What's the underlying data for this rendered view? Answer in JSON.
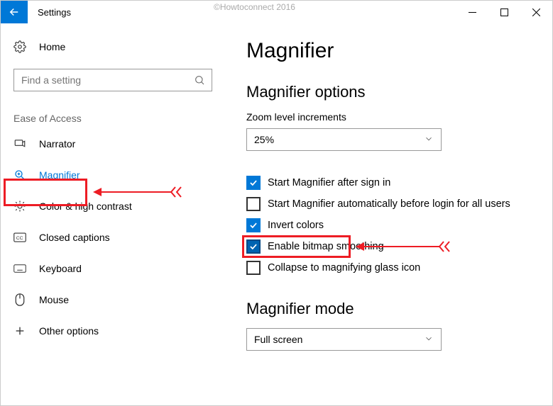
{
  "window": {
    "title": "Settings",
    "watermark": "©Howtoconnect 2016"
  },
  "sidebar": {
    "home": "Home",
    "search_placeholder": "Find a setting",
    "category": "Ease of Access",
    "items": [
      {
        "label": "Narrator"
      },
      {
        "label": "Magnifier"
      },
      {
        "label": "Color & high contrast"
      },
      {
        "label": "Closed captions"
      },
      {
        "label": "Keyboard"
      },
      {
        "label": "Mouse"
      },
      {
        "label": "Other options"
      }
    ]
  },
  "main": {
    "title": "Magnifier",
    "options_heading": "Magnifier options",
    "zoom_label": "Zoom level increments",
    "zoom_value": "25%",
    "checks": {
      "start_after_signin": "Start Magnifier after sign in",
      "start_before_login": "Start Magnifier automatically before login for all users",
      "invert_colors": "Invert colors",
      "bitmap_smoothing": "Enable bitmap smoothing",
      "collapse_glass": "Collapse to magnifying glass icon"
    },
    "mode_heading": "Magnifier mode",
    "mode_value": "Full screen"
  }
}
